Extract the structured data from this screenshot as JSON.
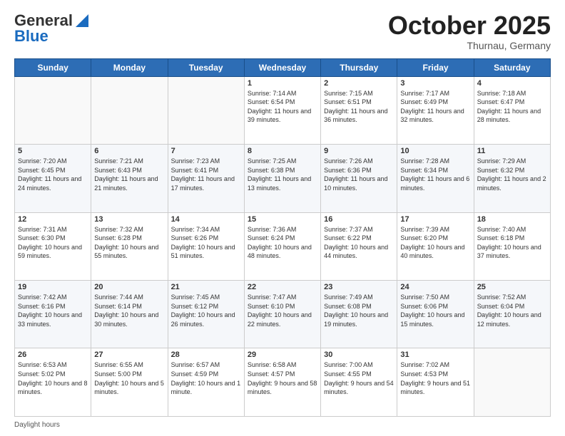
{
  "header": {
    "logo_general": "General",
    "logo_blue": "Blue",
    "month_title": "October 2025",
    "subtitle": "Thurnau, Germany"
  },
  "weekdays": [
    "Sunday",
    "Monday",
    "Tuesday",
    "Wednesday",
    "Thursday",
    "Friday",
    "Saturday"
  ],
  "footer": {
    "daylight_label": "Daylight hours"
  },
  "weeks": [
    [
      {
        "day": "",
        "info": ""
      },
      {
        "day": "",
        "info": ""
      },
      {
        "day": "",
        "info": ""
      },
      {
        "day": "1",
        "info": "Sunrise: 7:14 AM\nSunset: 6:54 PM\nDaylight: 11 hours\nand 39 minutes."
      },
      {
        "day": "2",
        "info": "Sunrise: 7:15 AM\nSunset: 6:51 PM\nDaylight: 11 hours\nand 36 minutes."
      },
      {
        "day": "3",
        "info": "Sunrise: 7:17 AM\nSunset: 6:49 PM\nDaylight: 11 hours\nand 32 minutes."
      },
      {
        "day": "4",
        "info": "Sunrise: 7:18 AM\nSunset: 6:47 PM\nDaylight: 11 hours\nand 28 minutes."
      }
    ],
    [
      {
        "day": "5",
        "info": "Sunrise: 7:20 AM\nSunset: 6:45 PM\nDaylight: 11 hours\nand 24 minutes."
      },
      {
        "day": "6",
        "info": "Sunrise: 7:21 AM\nSunset: 6:43 PM\nDaylight: 11 hours\nand 21 minutes."
      },
      {
        "day": "7",
        "info": "Sunrise: 7:23 AM\nSunset: 6:41 PM\nDaylight: 11 hours\nand 17 minutes."
      },
      {
        "day": "8",
        "info": "Sunrise: 7:25 AM\nSunset: 6:38 PM\nDaylight: 11 hours\nand 13 minutes."
      },
      {
        "day": "9",
        "info": "Sunrise: 7:26 AM\nSunset: 6:36 PM\nDaylight: 11 hours\nand 10 minutes."
      },
      {
        "day": "10",
        "info": "Sunrise: 7:28 AM\nSunset: 6:34 PM\nDaylight: 11 hours\nand 6 minutes."
      },
      {
        "day": "11",
        "info": "Sunrise: 7:29 AM\nSunset: 6:32 PM\nDaylight: 11 hours\nand 2 minutes."
      }
    ],
    [
      {
        "day": "12",
        "info": "Sunrise: 7:31 AM\nSunset: 6:30 PM\nDaylight: 10 hours\nand 59 minutes."
      },
      {
        "day": "13",
        "info": "Sunrise: 7:32 AM\nSunset: 6:28 PM\nDaylight: 10 hours\nand 55 minutes."
      },
      {
        "day": "14",
        "info": "Sunrise: 7:34 AM\nSunset: 6:26 PM\nDaylight: 10 hours\nand 51 minutes."
      },
      {
        "day": "15",
        "info": "Sunrise: 7:36 AM\nSunset: 6:24 PM\nDaylight: 10 hours\nand 48 minutes."
      },
      {
        "day": "16",
        "info": "Sunrise: 7:37 AM\nSunset: 6:22 PM\nDaylight: 10 hours\nand 44 minutes."
      },
      {
        "day": "17",
        "info": "Sunrise: 7:39 AM\nSunset: 6:20 PM\nDaylight: 10 hours\nand 40 minutes."
      },
      {
        "day": "18",
        "info": "Sunrise: 7:40 AM\nSunset: 6:18 PM\nDaylight: 10 hours\nand 37 minutes."
      }
    ],
    [
      {
        "day": "19",
        "info": "Sunrise: 7:42 AM\nSunset: 6:16 PM\nDaylight: 10 hours\nand 33 minutes."
      },
      {
        "day": "20",
        "info": "Sunrise: 7:44 AM\nSunset: 6:14 PM\nDaylight: 10 hours\nand 30 minutes."
      },
      {
        "day": "21",
        "info": "Sunrise: 7:45 AM\nSunset: 6:12 PM\nDaylight: 10 hours\nand 26 minutes."
      },
      {
        "day": "22",
        "info": "Sunrise: 7:47 AM\nSunset: 6:10 PM\nDaylight: 10 hours\nand 22 minutes."
      },
      {
        "day": "23",
        "info": "Sunrise: 7:49 AM\nSunset: 6:08 PM\nDaylight: 10 hours\nand 19 minutes."
      },
      {
        "day": "24",
        "info": "Sunrise: 7:50 AM\nSunset: 6:06 PM\nDaylight: 10 hours\nand 15 minutes."
      },
      {
        "day": "25",
        "info": "Sunrise: 7:52 AM\nSunset: 6:04 PM\nDaylight: 10 hours\nand 12 minutes."
      }
    ],
    [
      {
        "day": "26",
        "info": "Sunrise: 6:53 AM\nSunset: 5:02 PM\nDaylight: 10 hours\nand 8 minutes."
      },
      {
        "day": "27",
        "info": "Sunrise: 6:55 AM\nSunset: 5:00 PM\nDaylight: 10 hours\nand 5 minutes."
      },
      {
        "day": "28",
        "info": "Sunrise: 6:57 AM\nSunset: 4:59 PM\nDaylight: 10 hours\nand 1 minute."
      },
      {
        "day": "29",
        "info": "Sunrise: 6:58 AM\nSunset: 4:57 PM\nDaylight: 9 hours\nand 58 minutes."
      },
      {
        "day": "30",
        "info": "Sunrise: 7:00 AM\nSunset: 4:55 PM\nDaylight: 9 hours\nand 54 minutes."
      },
      {
        "day": "31",
        "info": "Sunrise: 7:02 AM\nSunset: 4:53 PM\nDaylight: 9 hours\nand 51 minutes."
      },
      {
        "day": "",
        "info": ""
      }
    ]
  ]
}
